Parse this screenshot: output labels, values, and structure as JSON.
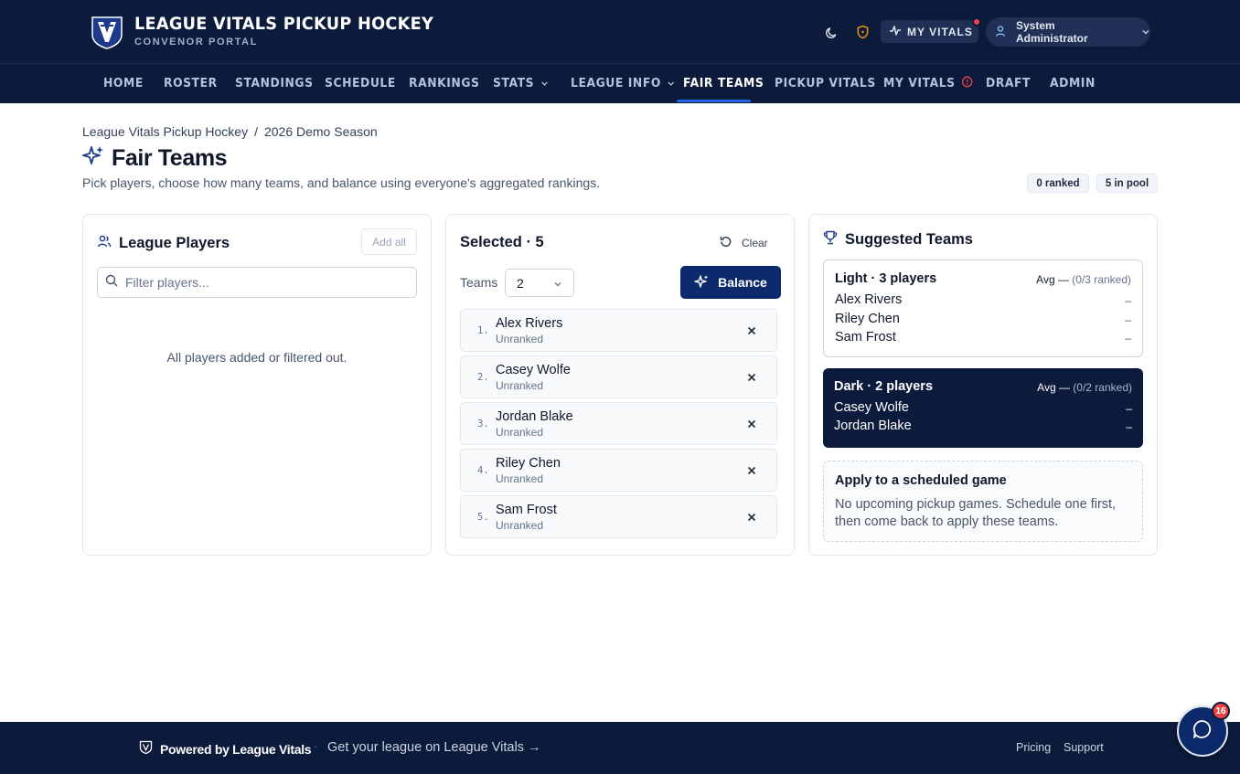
{
  "brand": {
    "title": "LEAGUE VITALS PICKUP HOCKEY",
    "subtitle": "CONVENOR PORTAL"
  },
  "header": {
    "my_vitals_label": "MY VITALS",
    "user_name": "System Administrator",
    "icons": [
      "moon-icon",
      "shield-alert-icon",
      "activity-icon",
      "user-icon",
      "chevron-down-icon"
    ]
  },
  "nav": {
    "items": [
      {
        "label": "HOME"
      },
      {
        "label": "ROSTER"
      },
      {
        "label": "STANDINGS"
      },
      {
        "label": "SCHEDULE"
      },
      {
        "label": "RANKINGS"
      },
      {
        "label": "STATS"
      },
      {
        "label": "LEAGUE INFO"
      },
      {
        "label": "FAIR TEAMS"
      },
      {
        "label": "PICKUP VITALS"
      },
      {
        "label": "MY VITALS"
      },
      {
        "label": "DRAFT"
      },
      {
        "label": "ADMIN"
      }
    ],
    "active": "FAIR TEAMS"
  },
  "breadcrumb": {
    "league": "League Vitals Pickup Hockey",
    "separator": "/",
    "season": "2026 Demo Season"
  },
  "page": {
    "title": "Fair Teams",
    "subtitle": "Pick players, choose how many teams, and balance using everyone's aggregated rankings.",
    "ranked_pill": "0 ranked",
    "pool_pill": "5 in pool"
  },
  "league_players": {
    "title": "League Players",
    "add_all_label": "Add all",
    "search_placeholder": "Filter players...",
    "search_value": "",
    "empty_message": "All players added or filtered out."
  },
  "selected": {
    "title": "Selected · 5",
    "clear_label": "Clear",
    "teams_label": "Teams",
    "teams_value": "2",
    "balance_label": "Balance",
    "players": [
      {
        "num": "1.",
        "name": "Alex Rivers",
        "status": "Unranked"
      },
      {
        "num": "2.",
        "name": "Casey Wolfe",
        "status": "Unranked"
      },
      {
        "num": "3.",
        "name": "Jordan Blake",
        "status": "Unranked"
      },
      {
        "num": "4.",
        "name": "Riley Chen",
        "status": "Unranked"
      },
      {
        "num": "5.",
        "name": "Sam Frost",
        "status": "Unranked"
      }
    ]
  },
  "suggested": {
    "title": "Suggested Teams",
    "teams": [
      {
        "header": "Light · 3 players",
        "avg": "Avg —",
        "ranked": "(0/3 ranked)",
        "players": [
          {
            "name": "Alex Rivers",
            "value": "–"
          },
          {
            "name": "Riley Chen",
            "value": "–"
          },
          {
            "name": "Sam Frost",
            "value": "–"
          }
        ]
      },
      {
        "header": "Dark · 2 players",
        "avg": "Avg —",
        "ranked": "(0/2 ranked)",
        "players": [
          {
            "name": "Casey Wolfe",
            "value": "–"
          },
          {
            "name": "Jordan Blake",
            "value": "–"
          }
        ]
      }
    ],
    "apply_title": "Apply to a scheduled game",
    "apply_text": "No upcoming pickup games. Schedule one first, then come back to apply these teams."
  },
  "footer": {
    "powered_by": "Powered by League Vitals",
    "dot": "·",
    "cta": "Get your league on League Vitals →",
    "pricing": "Pricing",
    "support": "Support"
  },
  "chat": {
    "badge": "16"
  },
  "colors": {
    "navy": "#0c1a3b",
    "accent": "#2563eb",
    "button": "#0c2a6b",
    "alert": "#ef4444"
  }
}
